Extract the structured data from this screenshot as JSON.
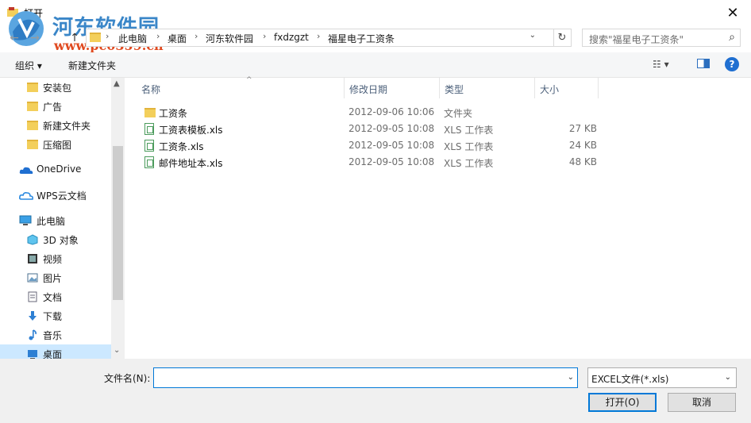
{
  "window": {
    "title": "打开",
    "close_glyph": "✕"
  },
  "watermark": {
    "title": "河东软件园",
    "url": "www.pc0359.cn"
  },
  "nav_buttons": {
    "back": "←",
    "forward": "→",
    "up": "↑"
  },
  "address": {
    "crumbs": [
      "此电脑",
      "桌面",
      "河东软件园",
      "fxdzgzt",
      "福星电子工资条"
    ],
    "separator": "›",
    "dropdown_glyph": "⌄",
    "refresh_glyph": "↻"
  },
  "search": {
    "placeholder": "搜索\"福星电子工资条\"",
    "icon_glyph": "⌕"
  },
  "toolbar": {
    "organize_label": "组织 ▾",
    "new_folder_label": "新建文件夹",
    "view_label": "☷ ▾",
    "help_glyph": "?"
  },
  "navpane": {
    "items": [
      {
        "label": "安装包",
        "icon": "folder-icon"
      },
      {
        "label": "广告",
        "icon": "folder-icon"
      },
      {
        "label": "新建文件夹",
        "icon": "folder-icon"
      },
      {
        "label": "压缩图",
        "icon": "folder-icon"
      },
      {
        "label": "OneDrive",
        "icon": "cloud-icon"
      },
      {
        "label": "WPS云文档",
        "icon": "wps-cloud-icon"
      },
      {
        "label": "此电脑",
        "icon": "computer-icon"
      },
      {
        "label": "3D 对象",
        "icon": "cube-icon"
      },
      {
        "label": "视频",
        "icon": "video-icon"
      },
      {
        "label": "图片",
        "icon": "picture-icon"
      },
      {
        "label": "文档",
        "icon": "document-icon"
      },
      {
        "label": "下载",
        "icon": "download-icon"
      },
      {
        "label": "音乐",
        "icon": "music-icon"
      },
      {
        "label": "桌面",
        "icon": "desktop-icon",
        "selected": true
      }
    ],
    "scroll_up": "▲",
    "scroll_down": "⌄"
  },
  "columns": {
    "name": "名称",
    "modified": "修改日期",
    "type": "类型",
    "size": "大小",
    "sort_glyph": "^"
  },
  "files": [
    {
      "name": "工资条",
      "modified": "2012-09-06 10:06",
      "type": "文件夹",
      "size": "",
      "icon": "folder-icon"
    },
    {
      "name": "工资表模板.xls",
      "modified": "2012-09-05 10:08",
      "type": "XLS 工作表",
      "size": "27 KB",
      "icon": "xls-icon"
    },
    {
      "name": "工资条.xls",
      "modified": "2012-09-05 10:08",
      "type": "XLS 工作表",
      "size": "24 KB",
      "icon": "xls-icon"
    },
    {
      "name": "邮件地址本.xls",
      "modified": "2012-09-05 10:08",
      "type": "XLS 工作表",
      "size": "48 KB",
      "icon": "xls-icon"
    }
  ],
  "bottom": {
    "filename_label": "文件名(N):",
    "filename_value": "",
    "filter_value": "EXCEL文件(*.xls)",
    "dropdown_glyph": "⌄",
    "open_label": "打开(O)",
    "cancel_label": "取消"
  },
  "colors": {
    "accent": "#0078d7",
    "selected_bg": "#cce8ff",
    "folder": "#f3cf5b",
    "watermark_blue": "#3a86c8",
    "watermark_red": "#e0491f"
  }
}
